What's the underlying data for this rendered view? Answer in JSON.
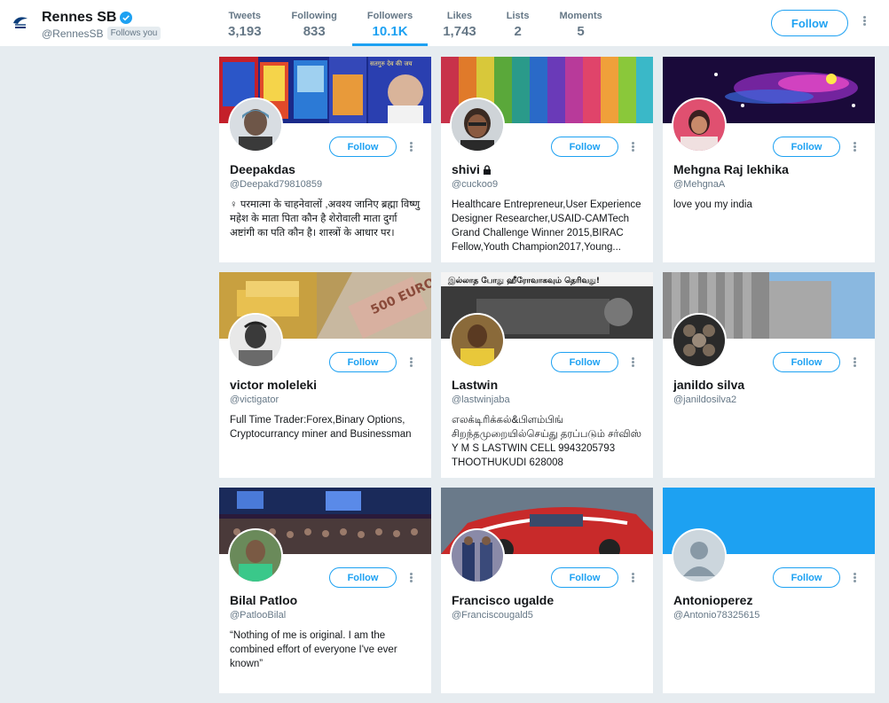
{
  "profile": {
    "name": "Rennes SB",
    "handle": "@RennesSB",
    "follows_you": "Follows you"
  },
  "stats": [
    {
      "label": "Tweets",
      "value": "3,193"
    },
    {
      "label": "Following",
      "value": "833"
    },
    {
      "label": "Followers",
      "value": "10.1K",
      "active": true
    },
    {
      "label": "Likes",
      "value": "1,743"
    },
    {
      "label": "Lists",
      "value": "2"
    },
    {
      "label": "Moments",
      "value": "5"
    }
  ],
  "follow_label": "Follow",
  "colors": {
    "accent": "#1da1f2",
    "background": "#e6ecf0",
    "muted": "#657786"
  },
  "cards": [
    {
      "name": "Deepakdas",
      "handle": "@Deepakd79810859",
      "bio": "♀ परमात्मा के चाहनेवालों ,अवश्य जानिए ब्रह्मा विष्णु महेश के माता पिता कौन है शेरोवाली माता दुर्गा अष्टांगी का पति कौन है। शास्त्रों के आधार पर।",
      "follow": "Follow",
      "locked": false
    },
    {
      "name": "shivi",
      "handle": "@cuckoo9",
      "bio": "Healthcare Entrepreneur,User Experience Designer Researcher,USAID-CAMTech Grand Challenge Winner 2015,BIRAC Fellow,Youth Champion2017,Young...",
      "follow": "Follow",
      "locked": true
    },
    {
      "name": "Mehgna Raj lekhika",
      "handle": "@MehgnaA",
      "bio": "love you my india",
      "follow": "Follow",
      "locked": false
    },
    {
      "name": "victor moleleki",
      "handle": "@victigator",
      "bio": "Full Time Trader:Forex,Binary Options, Cryptocurrancy miner and Businessman",
      "follow": "Follow",
      "locked": false
    },
    {
      "name": "Lastwin",
      "handle": "@lastwinjaba",
      "bio": "எலக்டிரிக்கல்&பிளம்பிங் சிறந்தமுறையில்செய்து தரப்படும் சர்விஸ் Y M S LASTWIN CELL 9943205793 THOOTHUKUDI 628008",
      "follow": "Follow",
      "locked": false
    },
    {
      "name": "janildo silva",
      "handle": "@janildosilva2",
      "bio": "",
      "follow": "Follow",
      "locked": false
    },
    {
      "name": "Bilal Patloo",
      "handle": "@PatlooBilal",
      "bio": "“Nothing of me is original. I am the combined effort of everyone I've ever known”",
      "follow": "Follow",
      "locked": false
    },
    {
      "name": "Francisco ugalde",
      "handle": "@Franciscougald5",
      "bio": "",
      "follow": "Follow",
      "locked": false
    },
    {
      "name": "Antonioperez",
      "handle": "@Antonio78325615",
      "bio": "",
      "follow": "Follow",
      "locked": false
    }
  ],
  "banners": {
    "0": {
      "text": "सतगुरु देव की जय"
    },
    "4": {
      "text": "இல்லாத போது ஹீரோவாகவும் தெரிவது!"
    },
    "3": {
      "text": "500 EURO"
    }
  }
}
